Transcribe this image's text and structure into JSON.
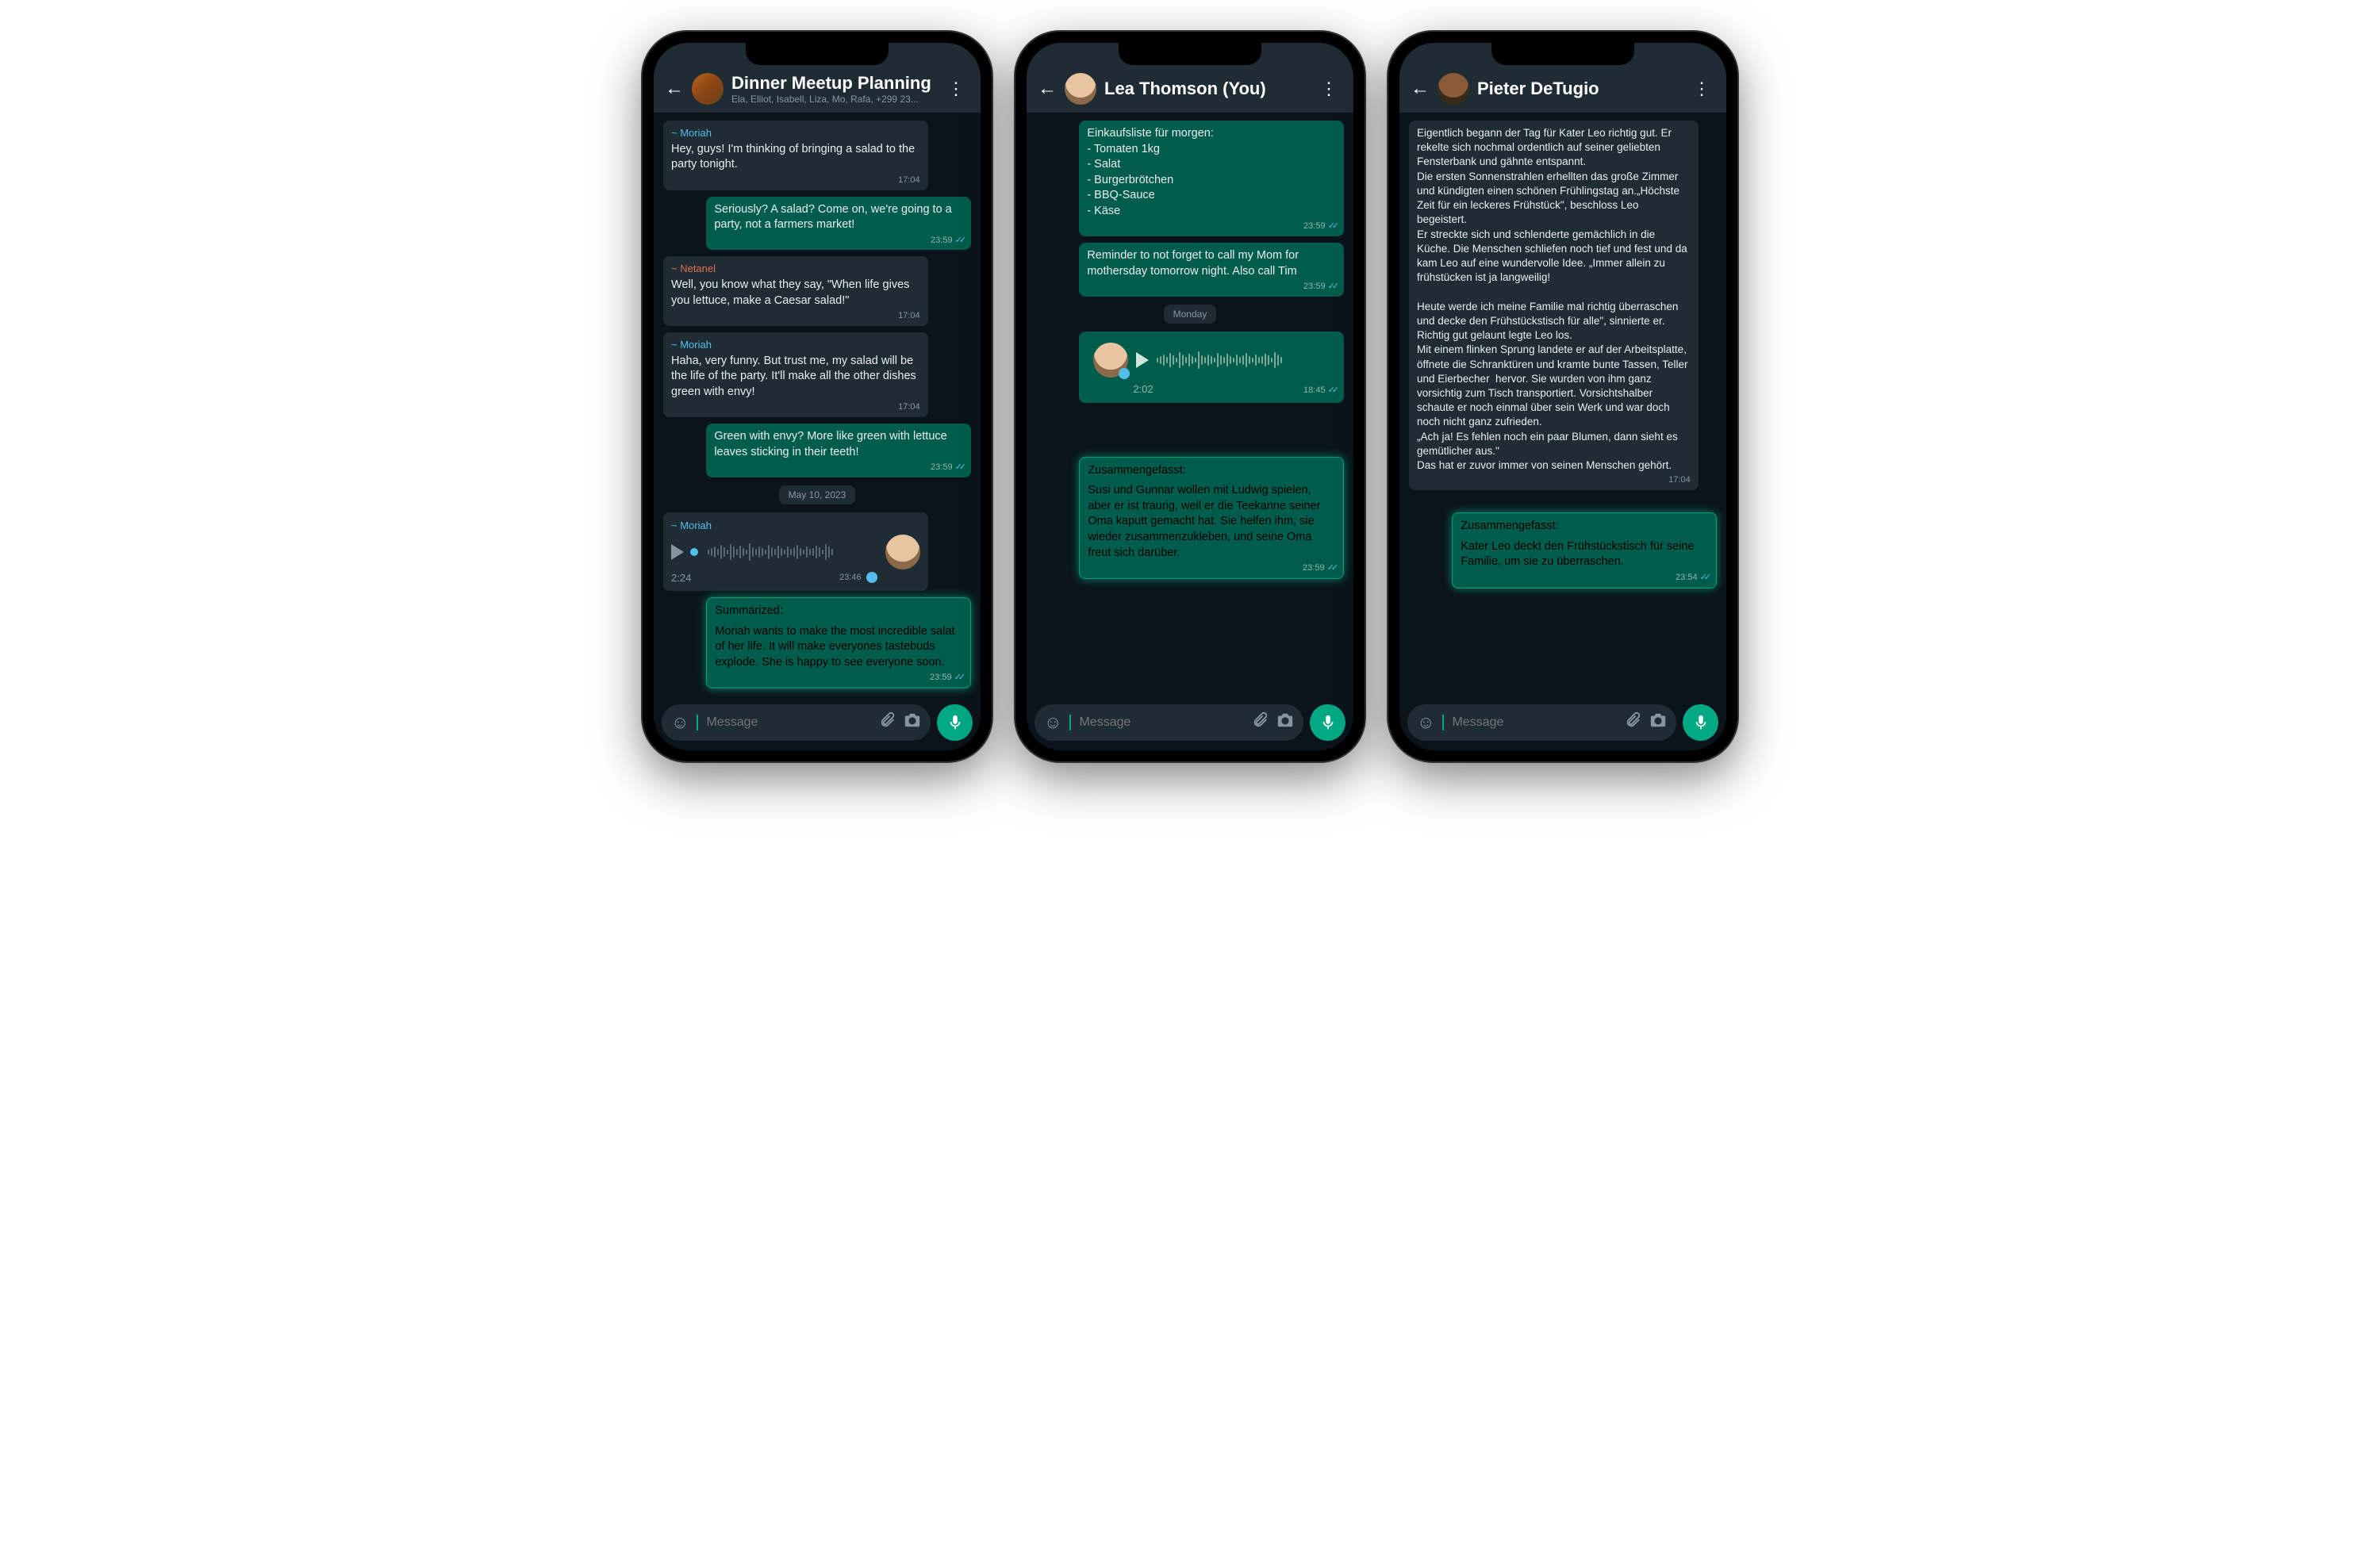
{
  "phones": [
    {
      "title": "Dinner Meetup Planning",
      "subtitle": "Ela, Elliot, Isabell, Liza, Mo, Rafa, +299 23...",
      "input_placeholder": "Message",
      "date_chip": "May 10, 2023",
      "messages": {
        "m1_sender": "~ Moriah",
        "m1_text": "Hey, guys! I'm thinking of bringing a salad to the party tonight.",
        "m1_time": "17:04",
        "m2_text": "Seriously? A salad? Come on, we're going to a party, not a farmers market!",
        "m2_time": "23:59",
        "m3_sender": "~ Netanel",
        "m3_text": "Well, you know what they say, \"When life gives you lettuce, make a Caesar salad!\"",
        "m3_time": "17:04",
        "m4_sender": "~ Moriah",
        "m4_text": "Haha, very funny. But trust me, my salad will be the life of the party. It'll make all the other dishes green with envy!",
        "m4_time": "17:04",
        "m5_text": "Green with envy? More like green with lettuce leaves sticking in their teeth!",
        "m5_time": "23:59",
        "voice_sender": "~ Moriah",
        "voice_dur": "2:24",
        "voice_time": "23:46",
        "sum_title": "Summarized:",
        "sum_text": "Moriah wants to make the most incredible salat of her life. It will make everyones tastebuds explode. She is happy to see everyone soon.",
        "sum_time": "23:59"
      }
    },
    {
      "title": "Lea Thomson (You)",
      "input_placeholder": "Message",
      "date_chip": "Monday",
      "messages": {
        "m1_text": "Einkaufsliste für morgen:\n- Tomaten 1kg\n- Salat\n- Burgerbrötchen\n- BBQ-Sauce\n- Käse",
        "m1_time": "23:59",
        "m2_text": "Reminder to not forget to call my Mom for mothersday tomorrow night. Also call Tim",
        "m2_time": "23:59",
        "voice_dur": "2:02",
        "voice_time": "18:45",
        "sum_title": "Zusammengefasst:",
        "sum_text": "Susi und Gunnar wollen mit Ludwig spielen, aber er ist traurig, weil er die Teekanne seiner Oma kaputt gemacht hat. Sie helfen ihm, sie wieder zusammenzukleben, und seine Oma freut sich darüber.",
        "sum_time": "23:59"
      }
    },
    {
      "title": "Pieter DeTugio",
      "input_placeholder": "Message",
      "messages": {
        "m1_text": "Eigentlich begann der Tag für Kater Leo richtig gut. Er rekelte sich nochmal ordentlich auf seiner geliebten Fensterbank und gähnte entspannt.\nDie ersten Sonnenstrahlen erhellten das große Zimmer und kündigten einen schönen Frühlingstag an.„Höchste Zeit für ein leckeres Frühstück\", beschloss Leo begeistert.\nEr streckte sich und schlenderte gemächlich in die Küche. Die Menschen schliefen noch tief und fest und da kam Leo auf eine wundervolle Idee. „Immer allein zu frühstücken ist ja langweilig!\n\nHeute werde ich meine Familie mal richtig überraschen und decke den Frühstückstisch für alle\", sinnierte er. Richtig gut gelaunt legte Leo los.\nMit einem flinken Sprung landete er auf der Arbeitsplatte, öffnete die Schranktüren und kramte bunte Tassen, Teller und Eierbecher  hervor. Sie wurden von ihm ganz vorsichtig zum Tisch transportiert. Vorsichtshalber schaute er noch einmal über sein Werk und war doch noch nicht ganz zufrieden.\n„Ach ja! Es fehlen noch ein paar Blumen, dann sieht es gemütlicher aus.\"\nDas hat er zuvor immer von seinen Menschen gehört.",
        "m1_time": "17:04",
        "sum_title": "Zusammengefasst:",
        "sum_text": "Kater Leo deckt den Frühstückstisch für seine Familie, um sie zu überraschen.",
        "sum_time": "23:54"
      }
    }
  ]
}
